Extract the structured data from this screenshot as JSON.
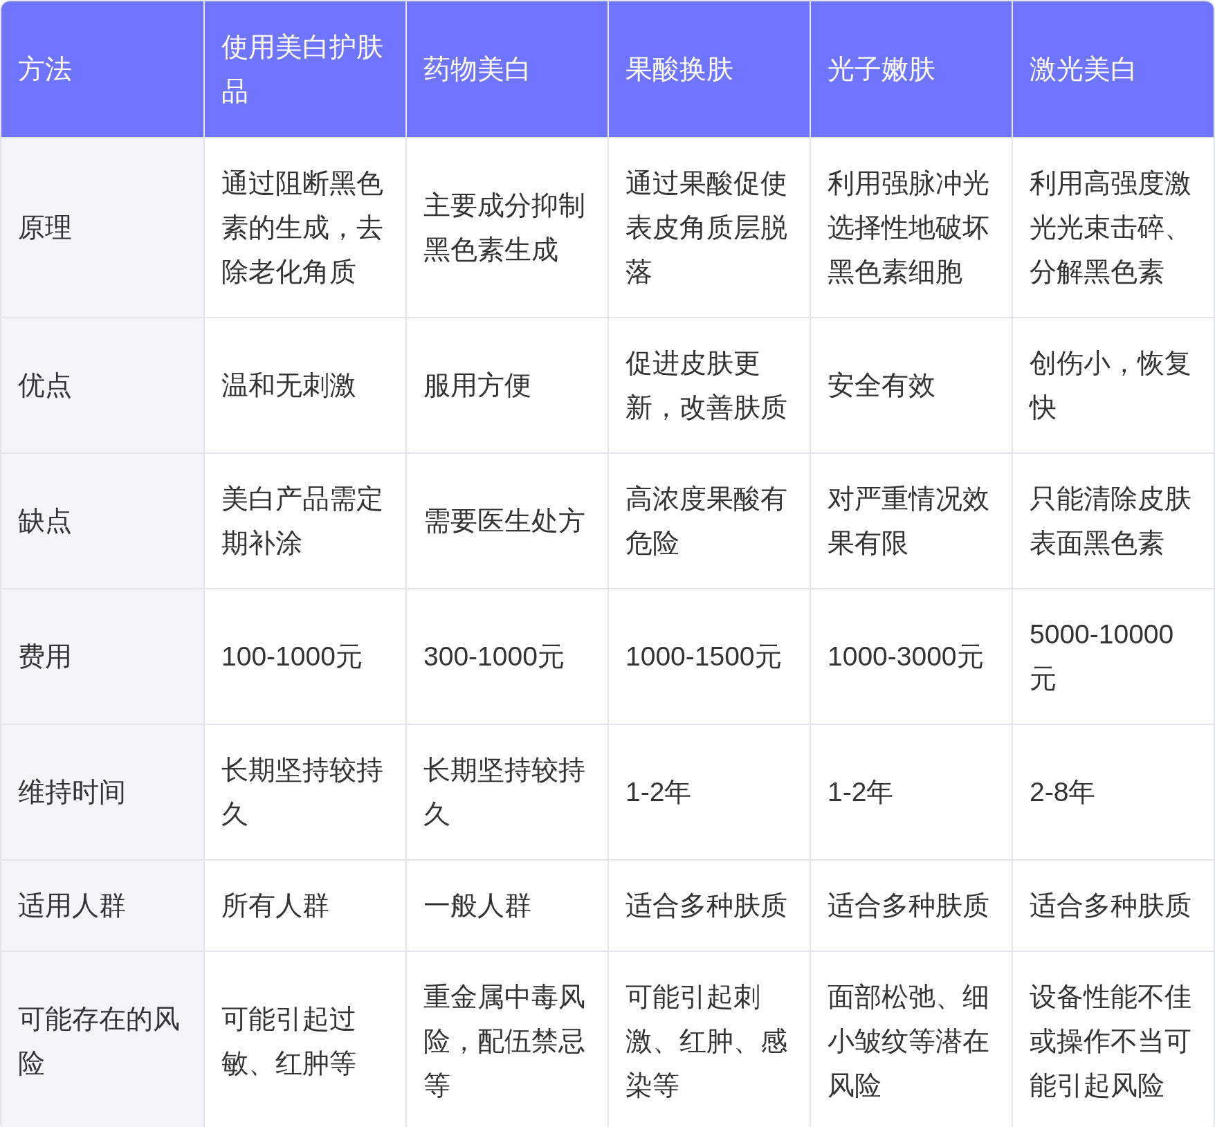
{
  "table": {
    "columns": [
      "方法",
      "使用美白护肤品",
      "药物美白",
      "果酸换肤",
      "光子嫩肤",
      "激光美白"
    ],
    "rows": [
      {
        "cells": [
          "原理",
          "通过阻断黑色素的生成，去除老化角质",
          "主要成分抑制黑色素生成",
          "通过果酸促使表皮角质层脱落",
          "利用强脉冲光选择性地破坏黑色素细胞",
          "利用高强度激光光束击碎、分解黑色素"
        ]
      },
      {
        "cells": [
          "优点",
          "温和无刺激",
          "服用方便",
          "促进皮肤更新，改善肤质",
          "安全有效",
          "创伤小，恢复快"
        ]
      },
      {
        "cells": [
          "缺点",
          "美白产品需定期补涂",
          "需要医生处方",
          "高浓度果酸有危险",
          "对严重情况效果有限",
          "只能清除皮肤表面黑色素"
        ]
      },
      {
        "cells": [
          "费用",
          "100-1000元",
          "300-1000元",
          "1000-1500元",
          "1000-3000元",
          "5000-10000元"
        ]
      },
      {
        "cells": [
          "维持时间",
          "长期坚持较持久",
          "长期坚持较持久",
          "1-2年",
          "1-2年",
          "2-8年"
        ]
      },
      {
        "cells": [
          "适用人群",
          "所有人群",
          "一般人群",
          "适合多种肤质",
          "适合多种肤质",
          "适合多种肤质"
        ]
      },
      {
        "cells": [
          "可能存在的风险",
          "可能引起过敏、红肿等",
          "重金属中毒风险，配伍禁忌等",
          "可能引起刺激、红肿、感染等",
          "面部松弛、细小皱纹等潜在风险",
          "设备性能不佳或操作不当可能引起风险"
        ]
      }
    ]
  }
}
